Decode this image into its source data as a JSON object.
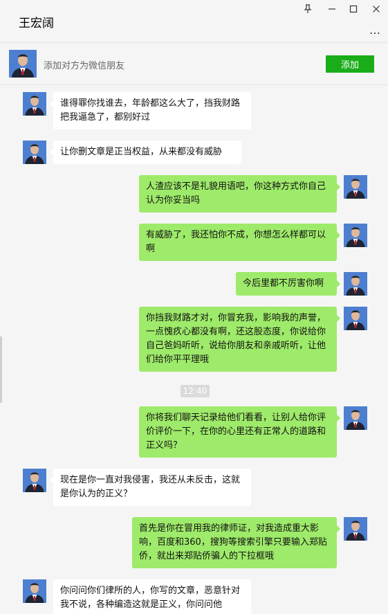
{
  "window": {
    "title": "王宏阔",
    "pin_glyph": "⊥",
    "minimize_glyph": "—",
    "maximize_glyph": "□",
    "close_glyph": "✕",
    "more_glyph": "…"
  },
  "add_friend": {
    "prompt": "添加对方为微信朋友",
    "button_label": "添加",
    "button_color": "#1aad19"
  },
  "colors": {
    "background": "#f5f5f5",
    "outgoing_bubble": "#9eea6a",
    "incoming_bubble": "#ffffff"
  },
  "messages": [
    {
      "side": "left",
      "text": "谁得罪你找谁去，年龄都这么大了，挡我财路把我逼急了，都别好过"
    },
    {
      "side": "left",
      "text": "让你删文章是正当权益，从来都没有威胁"
    },
    {
      "side": "right",
      "text": "人渣应该不是礼貌用语吧，你这种方式你自己认为你妥当吗"
    },
    {
      "side": "right",
      "text": "有威胁了，我还怕你不成，你想怎么样都可以啊"
    },
    {
      "side": "right",
      "text": "今后里都不厉害你啊"
    },
    {
      "side": "right",
      "text": "你挡我财路才对，你冒充我，影响我的声誉，一点愧疚心都没有啊，还这股态度，你说给你自己爸妈听听，说给你朋友和亲戚听听，让他们给你平平理哦"
    },
    {
      "side": "right",
      "text": "你将我们聊天记录给他们看看，让别人给你评价评价一下，在你的心里还有正常人的道路和正义吗？"
    },
    {
      "side": "left",
      "text": "现在是你一直对我侵害，我还从未反击，这就是你认为的正义？"
    },
    {
      "side": "right",
      "text": "首先是你在冒用我的律师证，对我造成重大影响，百度和360，搜狗等搜索引擎只要输入郑贴侨，就出来郑贴侨骗人的下拉框哦"
    },
    {
      "side": "left",
      "text": "你问问你们律所的人，你写的文章，恶意针对我不说，各种编造这就是正义，你问问他"
    }
  ],
  "timestamp": "12:40"
}
